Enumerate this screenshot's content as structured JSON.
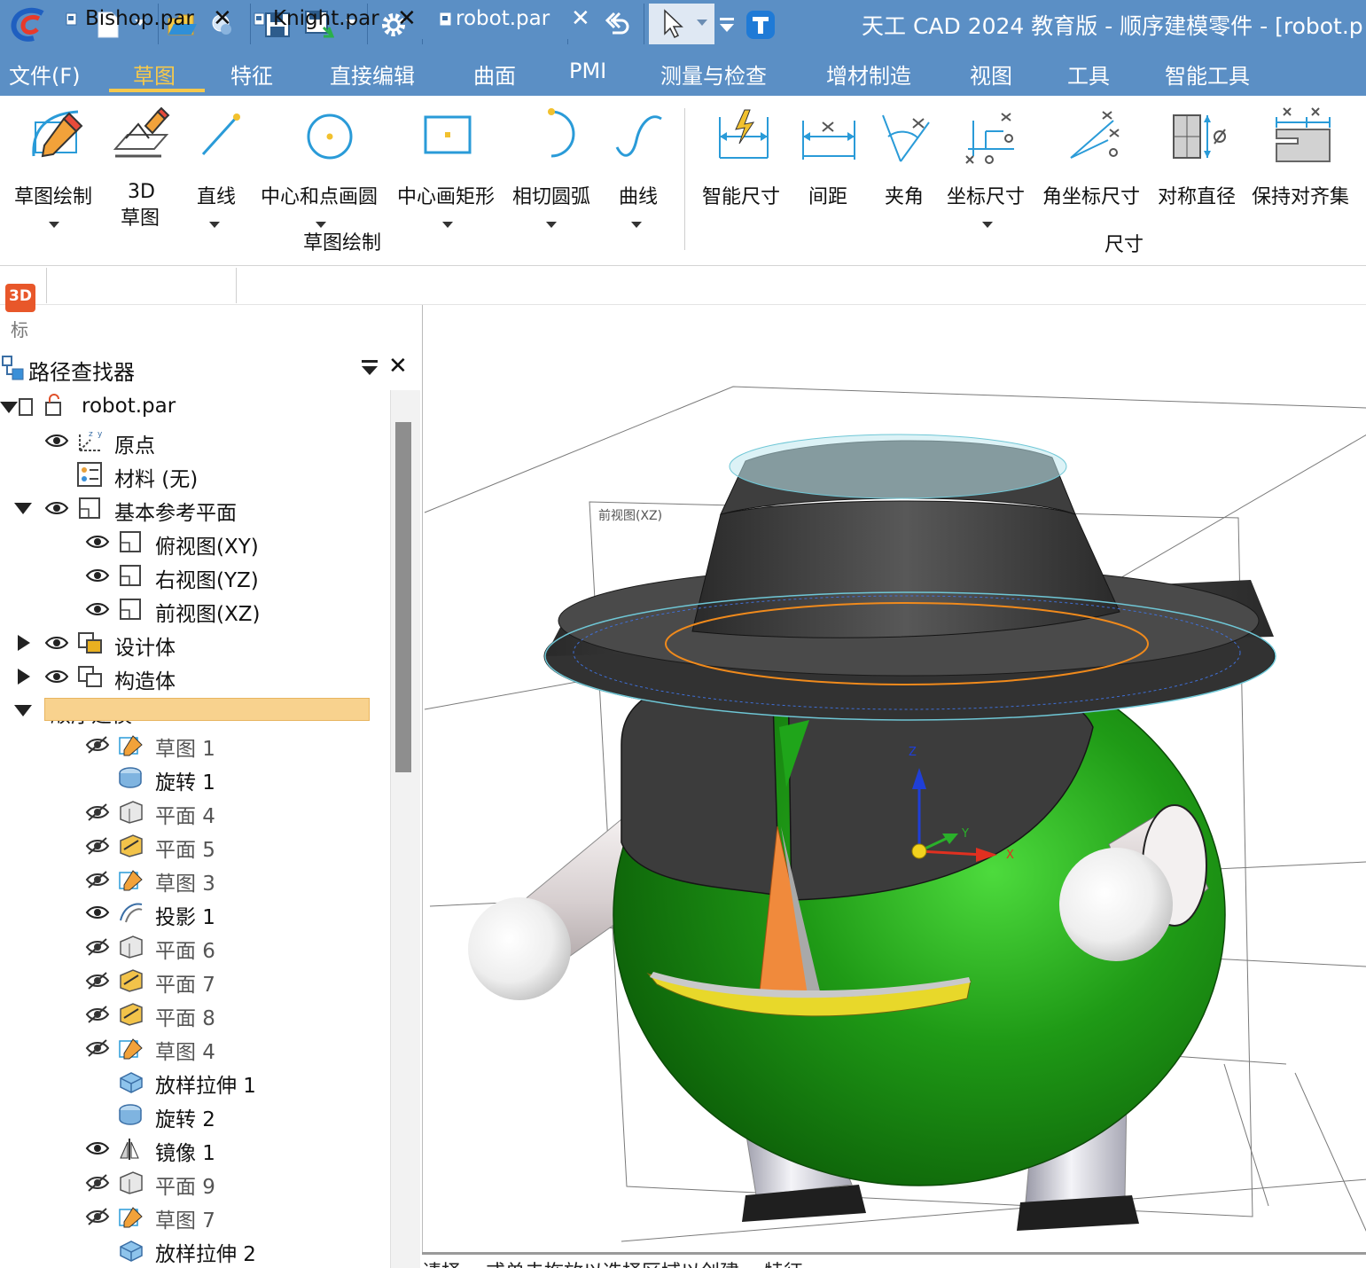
{
  "window": {
    "title": "天工 CAD 2024 教育版 - 顺序建模零件 - [robot.p"
  },
  "menu": {
    "items": [
      "文件(F)",
      "草图",
      "特征",
      "直接编辑",
      "曲面",
      "PMI",
      "测量与检查",
      "增材制造",
      "视图",
      "工具",
      "智能工具"
    ],
    "active": "草图"
  },
  "ribbon": {
    "sketch_group": {
      "label": "草图绘制",
      "buttons": [
        "草图绘制",
        "3D",
        "草图",
        "直线",
        "中心和点画圆",
        "中心画矩形",
        "相切圆弧",
        "曲线"
      ]
    },
    "dimension_group": {
      "label": "尺寸",
      "buttons": [
        "智能尺寸",
        "间距",
        "夹角",
        "坐标尺寸",
        "角坐标尺寸",
        "对称直径",
        "保持对齐集"
      ]
    }
  },
  "tabs": [
    {
      "label": "Bishop.par",
      "active": false
    },
    {
      "label": "Knight.par",
      "active": false
    },
    {
      "label": "robot.par",
      "active": true
    }
  ],
  "left_strip": {
    "badge": "3D",
    "label": "标"
  },
  "pathfinder": {
    "title": "路径查找器",
    "tree": [
      {
        "label": "robot.par",
        "level": 0
      },
      {
        "label": "原点",
        "level": 1
      },
      {
        "label": "材料 (无)",
        "level": 1
      },
      {
        "label": "基本参考平面",
        "level": 1
      },
      {
        "label": "俯视图(XY)",
        "level": 2
      },
      {
        "label": "右视图(YZ)",
        "level": 2
      },
      {
        "label": "前视图(XZ)",
        "level": 2
      },
      {
        "label": "设计体",
        "level": 1
      },
      {
        "label": "构造体",
        "level": 1
      },
      {
        "label": "顺序建模",
        "level": 1
      },
      {
        "label": "草图 1",
        "level": 2
      },
      {
        "label": "旋转 1",
        "level": 2
      },
      {
        "label": "平面 4",
        "level": 2
      },
      {
        "label": "平面 5",
        "level": 2
      },
      {
        "label": "草图 3",
        "level": 2
      },
      {
        "label": "投影 1",
        "level": 2
      },
      {
        "label": "平面 6",
        "level": 2
      },
      {
        "label": "平面 7",
        "level": 2
      },
      {
        "label": "平面 8",
        "level": 2
      },
      {
        "label": "草图 4",
        "level": 2
      },
      {
        "label": "放样拉伸 1",
        "level": 2
      },
      {
        "label": "旋转 2",
        "level": 2
      },
      {
        "label": "镜像 1",
        "level": 2
      },
      {
        "label": "平面 9",
        "level": 2
      },
      {
        "label": "草图 7",
        "level": 2
      },
      {
        "label": "放样拉伸 2",
        "level": 2
      }
    ]
  },
  "viewport": {
    "plane_label": "前视图(XZ)",
    "axes": {
      "x": "X",
      "y": "Y",
      "z": "Z"
    }
  },
  "status": {
    "text": "请择... 或单击拖放以选择区域以创建... 特征"
  },
  "colors": {
    "accent": "#5b8fc5",
    "active_menu": "#f5c84c",
    "body_green": "#1f9a16",
    "hat": "#3a3a3a",
    "nose": "#f08a3c",
    "mouth": "#e8d82a"
  }
}
